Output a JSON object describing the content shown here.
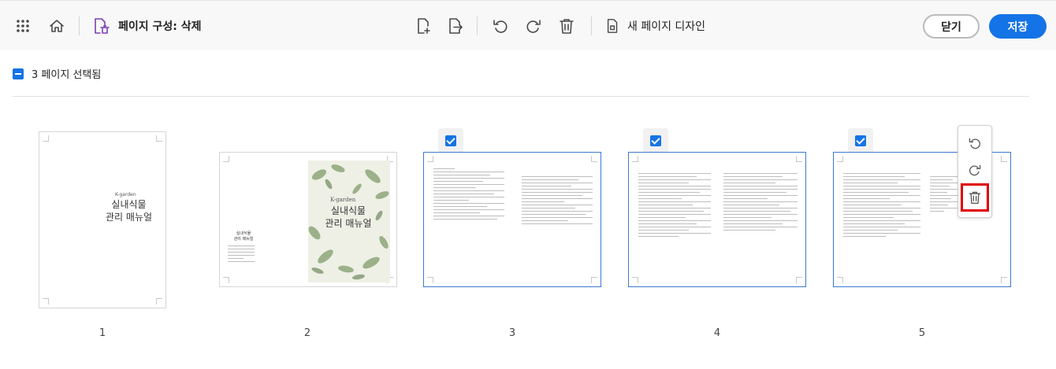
{
  "toolbar": {
    "apps_icon": "grid-icon",
    "home_icon": "home-icon",
    "tool_icon": "organize-delete-icon",
    "title": "페이지 구성: 삭제",
    "insert_icon": "insert-page-icon",
    "extract_icon": "extract-page-icon",
    "undo_icon": "undo-icon",
    "redo_icon": "redo-icon",
    "delete_icon": "trash-icon",
    "new_design_label": "새 페이지 디자인",
    "close_label": "닫기",
    "save_label": "저장",
    "accent_color": "#1473e6"
  },
  "selection": {
    "label": "3 페이지 선택됨"
  },
  "pages": [
    {
      "number": "1",
      "selected": false,
      "brand": "K-garden",
      "title_line1": "실내식물",
      "title_line2": "관리 매뉴얼"
    },
    {
      "number": "2",
      "selected": false,
      "brand": "K-garden",
      "title_line1": "실내식물",
      "title_line2": "관리 매뉴얼",
      "small_title_line1": "실내식물",
      "small_title_line2": "관리 매뉴얼"
    },
    {
      "number": "3",
      "selected": true
    },
    {
      "number": "4",
      "selected": true
    },
    {
      "number": "5",
      "selected": true
    }
  ],
  "hover_tools": {
    "rotate_left_icon": "rotate-left-icon",
    "rotate_right_icon": "rotate-right-icon",
    "delete_icon": "trash-icon",
    "highlight_color": "#e00000"
  }
}
